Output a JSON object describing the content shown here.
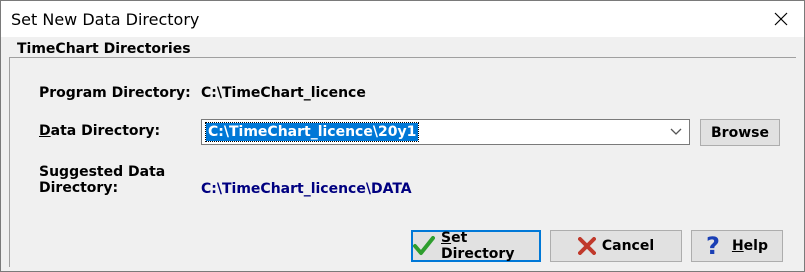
{
  "window": {
    "title": "Set New Data Directory"
  },
  "group": {
    "title": "TimeChart Directories"
  },
  "program_directory": {
    "label": "Program Directory:",
    "value": "C:\\TimeChart_licence"
  },
  "data_directory": {
    "label_accel": "D",
    "label_rest": "ata Directory:",
    "value": "C:\\TimeChart_licence\\20y1"
  },
  "suggested": {
    "label_line1": "Suggested Data",
    "label_line2": "Directory:",
    "value": "C:\\TimeChart_licence\\DATA"
  },
  "buttons": {
    "browse": "Browse",
    "set_accel": "S",
    "set_rest": "et Directory",
    "cancel": "Cancel",
    "help_accel": "H",
    "help_rest": "elp"
  },
  "colors": {
    "accent": "#0078d7",
    "suggested_text": "#000080",
    "cancel_icon": "#c0392b",
    "check_icon": "#2e9e2e",
    "help_icon": "#1a3fb5"
  }
}
